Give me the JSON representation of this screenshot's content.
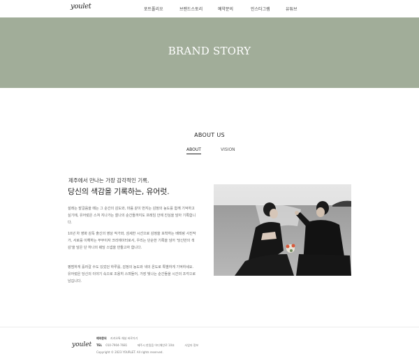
{
  "header": {
    "logo": "youlet",
    "nav": [
      "포트폴리오",
      "브랜드스토리",
      "예약문의",
      "인스타그램",
      "유튜브"
    ]
  },
  "banner": {
    "title": "BRAND STORY"
  },
  "about": {
    "section_title": "ABOUT US",
    "tabs": [
      "ABOUT",
      "VISION"
    ],
    "active_tab": "ABOUT",
    "subtitle": "제주에서 만나는 가장 감각적인 기록,",
    "title": "당신의 색감을 기록하는, 유어럿.",
    "paragraphs": [
      "설레는 발걸음을 떼는 그 순간의 감도와, 마음 같이 번지는 감정의 농도를 함께 기억하고 싶기에, 유어럿은 스쳐 지나가는 찰나의 순간들까지도 프레임 안에 진심을 담아 기록합니다.",
      "10년 차 영화 감독 출신의 영상 작가와, 섬세한 시선으로 감정을 포착하는 베테랑 사진작가, 서로를 이해하는 부부이자 크리에이터로서, 우리는 단순한 기록을 넘어 '당신만의 색감'을 담은 단 하나의 웨딩 스냅을 만들고자 합니다.",
      "평범하게 흘러갈 수도 있었던 하루를, 감정의 농도와 색의 온도로 특별하게 기억하세요. 유어럿은 당신의 이야기 속으로 조용히 스며들어, 가장 빛나는 순간들을 시간의 조각으로 남깁니다."
    ]
  },
  "footer": {
    "logo": "youlet",
    "row1_label": "예약문의",
    "row1_text": "카카오톡 채널 바로가기",
    "tel_label": "TEL",
    "tel": "010-7904-7681",
    "address": "제주시 한림읍 어디해안로 10호",
    "biz": "사업자 정보",
    "copyright": "Copyright © 2023 YOURLET. All rights reserved."
  },
  "colors": {
    "banner": "#a1ad99",
    "banner_text": "#ffffff"
  }
}
